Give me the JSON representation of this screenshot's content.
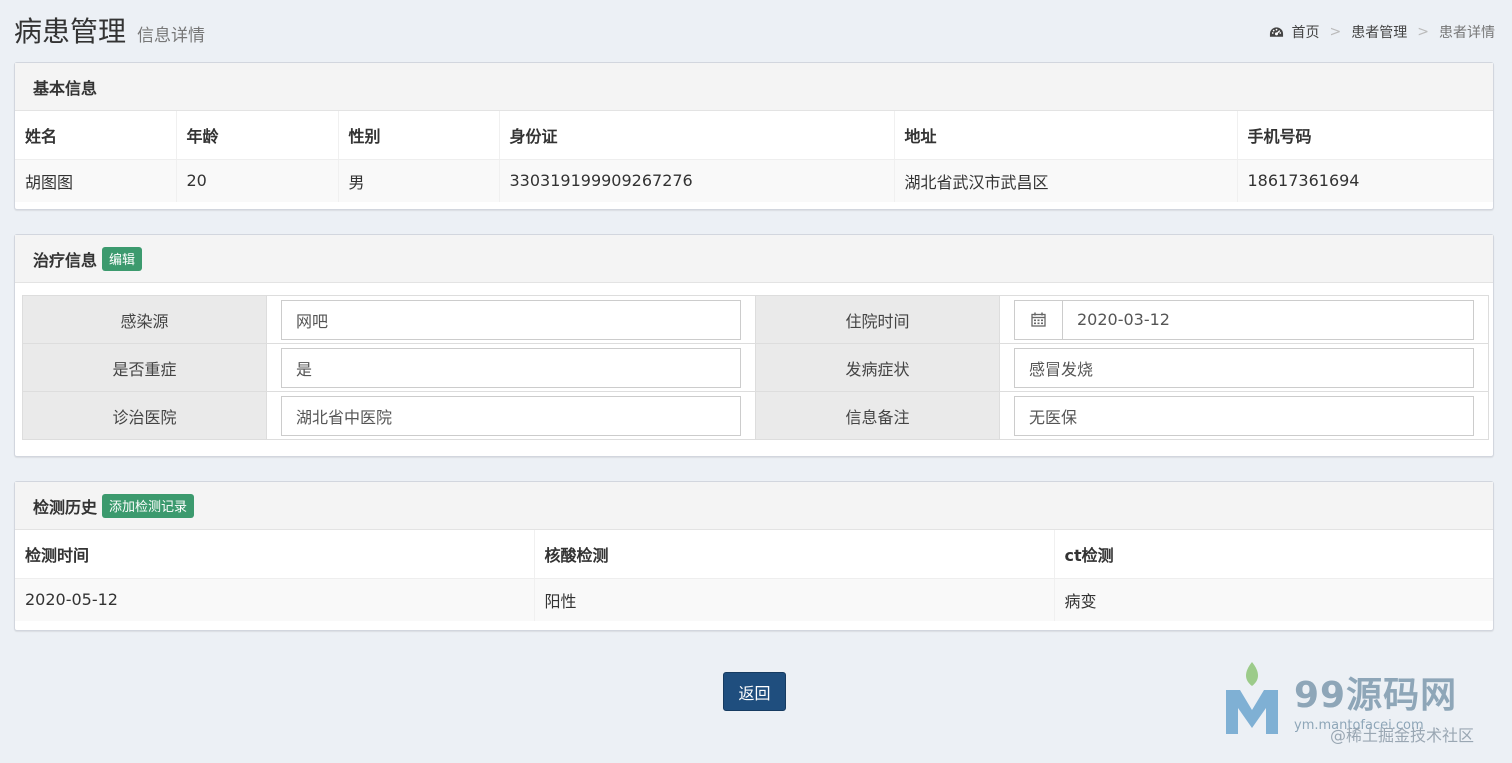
{
  "header": {
    "title": "病患管理",
    "subtitle": "信息详情",
    "breadcrumb": [
      {
        "label": "首页",
        "icon": "dashboard-icon"
      },
      {
        "label": "患者管理"
      },
      {
        "label": "患者详情"
      }
    ],
    "separator": ">"
  },
  "basic_info": {
    "title": "基本信息",
    "columns": [
      "姓名",
      "年龄",
      "性别",
      "身份证",
      "地址",
      "手机号码"
    ],
    "row": [
      "胡图图",
      "20",
      "男",
      "330319199909267276",
      "湖北省武汉市武昌区",
      "18617361694"
    ]
  },
  "treatment": {
    "title": "治疗信息",
    "edit_label": "编辑",
    "fields": {
      "source_label": "感染源",
      "source_value": "网吧",
      "admit_label": "住院时间",
      "admit_value": "2020-03-12",
      "severe_label": "是否重症",
      "severe_value": "是",
      "symptom_label": "发病症状",
      "symptom_value": "感冒发烧",
      "hospital_label": "诊治医院",
      "hospital_value": "湖北省中医院",
      "note_label": "信息备注",
      "note_value": "无医保"
    }
  },
  "history": {
    "title": "检测历史",
    "add_label": "添加检测记录",
    "columns": [
      "检测时间",
      "核酸检测",
      "ct检测"
    ],
    "rows": [
      [
        "2020-05-12",
        "阳性",
        "病变"
      ]
    ]
  },
  "actions": {
    "back_label": "返回"
  },
  "watermark": {
    "brand": "99源码网",
    "url": "ym.mantofacei.com",
    "credit": "@稀土掘金技术社区"
  },
  "colors": {
    "background": "#ecf0f5",
    "accent_green": "#3c9a6e",
    "primary_blue": "#1f4e7e"
  }
}
